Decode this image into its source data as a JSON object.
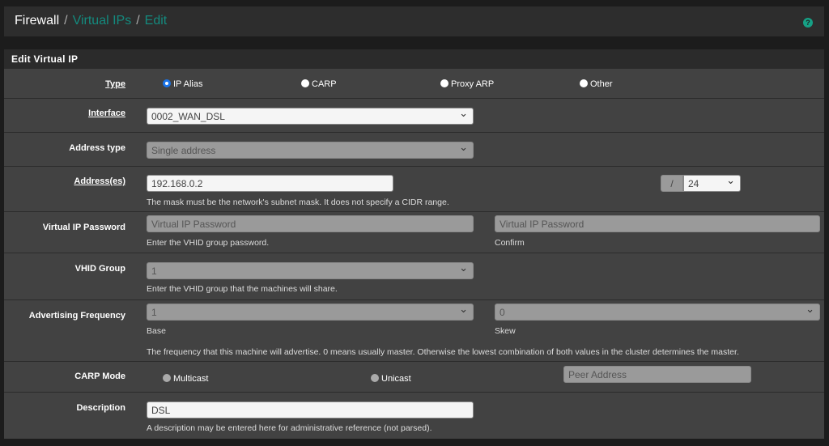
{
  "breadcrumb": {
    "root": "Firewall",
    "section": "Virtual IPs",
    "page": "Edit",
    "help": "?"
  },
  "panel_title": "Edit Virtual IP",
  "type": {
    "label": "Type",
    "options": [
      "IP Alias",
      "CARP",
      "Proxy ARP",
      "Other"
    ],
    "selected": "IP Alias"
  },
  "interface": {
    "label": "Interface",
    "value": "0002_WAN_DSL"
  },
  "address_type": {
    "label": "Address type",
    "value": "Single address"
  },
  "addresses": {
    "label": "Address(es)",
    "value": "192.168.0.2",
    "slash": "/",
    "mask": "24",
    "help": "The mask must be the network's subnet mask. It does not specify a CIDR range."
  },
  "password": {
    "label": "Virtual IP Password",
    "placeholder": "Virtual IP Password",
    "confirm_placeholder": "Virtual IP Password",
    "help": "Enter the VHID group password.",
    "confirm_help": "Confirm"
  },
  "vhid": {
    "label": "VHID Group",
    "value": "1",
    "help": "Enter the VHID group that the machines will share."
  },
  "adv": {
    "label": "Advertising Frequency",
    "base": "1",
    "skew": "0",
    "base_help": "Base",
    "skew_help": "Skew",
    "help": "The frequency that this machine will advertise. 0 means usually master. Otherwise the lowest combination of both values in the cluster determines the master."
  },
  "carp_mode": {
    "label": "CARP Mode",
    "options": [
      "Multicast",
      "Unicast"
    ],
    "peer_placeholder": "Peer Address"
  },
  "description": {
    "label": "Description",
    "value": "DSL",
    "help": "A description may be entered here for administrative reference (not parsed)."
  }
}
